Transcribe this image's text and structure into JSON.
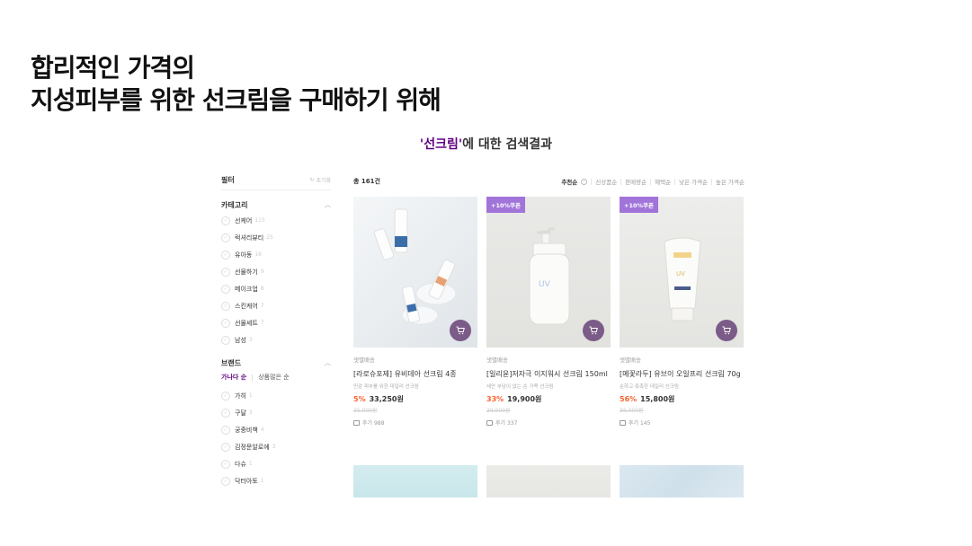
{
  "headline": {
    "line1": "합리적인 가격의",
    "line2": "지성피부를 위한 선크림을 구매하기 위해"
  },
  "result_title": {
    "keyword": "'선크림'",
    "suffix": "에 대한 검색결과"
  },
  "sidebar": {
    "filter_label": "필터",
    "reset_label": "초기화",
    "category_label": "카테고리",
    "categories": [
      {
        "label": "선케어",
        "count": "115"
      },
      {
        "label": "럭셔리뷰티",
        "count": "25"
      },
      {
        "label": "유아동",
        "count": "16"
      },
      {
        "label": "선물하기",
        "count": "9"
      },
      {
        "label": "메이크업",
        "count": "8"
      },
      {
        "label": "스킨케어",
        "count": "7"
      },
      {
        "label": "선물세트",
        "count": "7"
      },
      {
        "label": "남성",
        "count": "3"
      }
    ],
    "brand_label": "브랜드",
    "brand_sort_active": "가나다 순",
    "brand_sort_other": "상품많은 순",
    "brands": [
      {
        "label": "가히",
        "count": "1"
      },
      {
        "label": "구달",
        "count": "3"
      },
      {
        "label": "궁중비책",
        "count": "4"
      },
      {
        "label": "김정문알로에",
        "count": "3"
      },
      {
        "label": "다슈",
        "count": "1"
      },
      {
        "label": "닥터아토",
        "count": "1"
      }
    ]
  },
  "main": {
    "total_label": "총 161건",
    "sort_options": [
      "추천순",
      "신상품순",
      "판매량순",
      "혜택순",
      "낮은 가격순",
      "높은 가격순"
    ],
    "products": [
      {
        "coupon": "",
        "brand": "샛별배송",
        "name": "[라로슈포제] 유비데아 선크림 4종",
        "desc": "민감 피부를 위한 데일리 선크림",
        "discount": "5%",
        "price": "33,250원",
        "original": "35,000원",
        "reviews": "후기 988"
      },
      {
        "coupon": "+10%쿠폰",
        "brand": "샛별배송",
        "name": "[일리윤]저자극 이지워시 선크림 150ml",
        "desc": "세안 부담이 없는 순 가족 선크림",
        "discount": "33%",
        "price": "19,900원",
        "original": "29,900원",
        "reviews": "후기 337"
      },
      {
        "coupon": "+10%쿠폰",
        "brand": "샛별배송",
        "name": "[메꽃라두] 유브이 오일프리 선크림 70g",
        "desc": "순하고 촉촉한 데일리 선크림",
        "discount": "56%",
        "price": "15,800원",
        "original": "36,000원",
        "reviews": "후기 145"
      }
    ]
  }
}
